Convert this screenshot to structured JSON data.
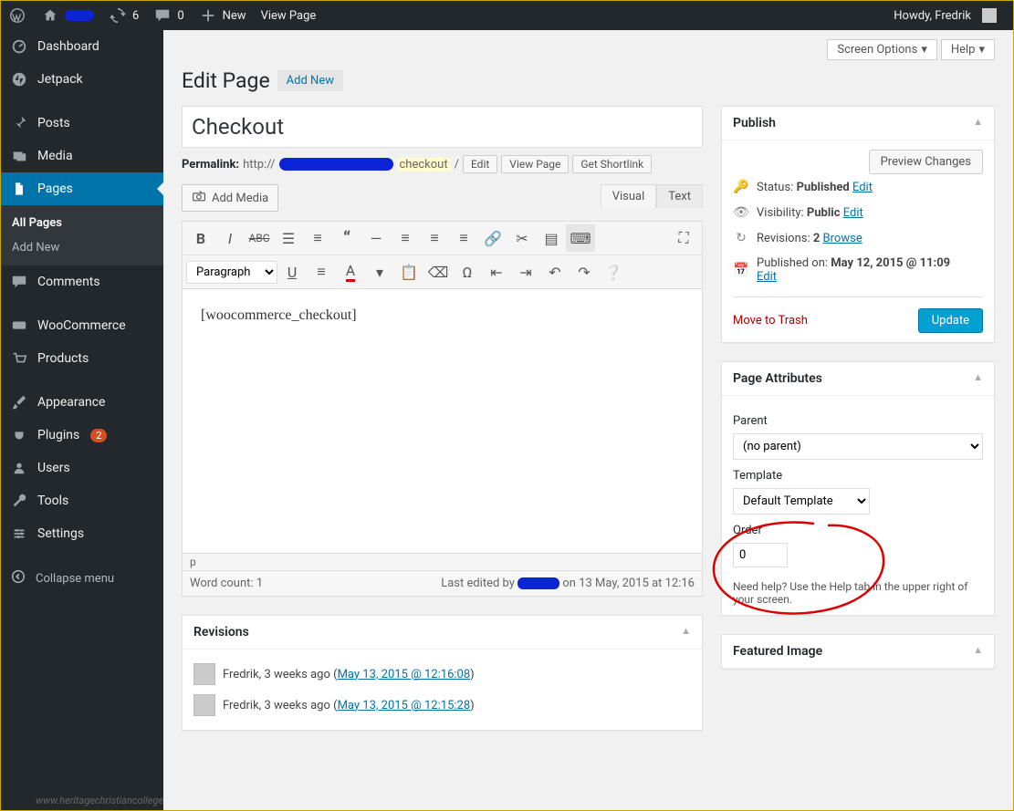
{
  "adminbar": {
    "comment_count": "0",
    "update_count": "6",
    "new_label": "New",
    "view_label": "View Page",
    "howdy": "Howdy, Fredrik"
  },
  "sidebar": {
    "items": [
      {
        "label": "Dashboard"
      },
      {
        "label": "Jetpack"
      },
      {
        "label": "Posts"
      },
      {
        "label": "Media"
      },
      {
        "label": "Pages"
      },
      {
        "label": "Comments"
      },
      {
        "label": "WooCommerce"
      },
      {
        "label": "Products"
      },
      {
        "label": "Appearance"
      },
      {
        "label": "Plugins"
      },
      {
        "label": "Users"
      },
      {
        "label": "Tools"
      },
      {
        "label": "Settings"
      }
    ],
    "plugins_badge": "2",
    "submenu": {
      "all": "All Pages",
      "add": "Add New"
    },
    "collapse": "Collapse menu"
  },
  "screen_options": "Screen Options",
  "help": "Help",
  "page_title": "Edit Page",
  "add_new": "Add New",
  "title_value": "Checkout",
  "permalink": {
    "label": "Permalink:",
    "prefix": "http://",
    "slug": "checkout",
    "tail": "/",
    "edit": "Edit",
    "view": "View Page",
    "shortlink": "Get Shortlink"
  },
  "media_button": "Add Media",
  "editor_tabs": {
    "visual": "Visual",
    "text": "Text"
  },
  "paragraph_label": "Paragraph",
  "editor_content": "[woocommerce_checkout]",
  "status_path": "p",
  "word_count_label": "Word count: 1",
  "last_edited_pre": "Last edited by ",
  "last_edited_post": " on 13 May, 2015 at 12:16",
  "revisions_box": {
    "title": "Revisions",
    "items": [
      {
        "who": "Fredrik, 3 weeks ago",
        "date": "May 13, 2015 @ 12:16:08"
      },
      {
        "who": "Fredrik, 3 weeks ago",
        "date": "May 13, 2015 @ 12:15:28"
      }
    ]
  },
  "publish": {
    "title": "Publish",
    "preview": "Preview Changes",
    "status_label": "Status:",
    "status_value": "Published",
    "visibility_label": "Visibility:",
    "visibility_value": "Public",
    "revisions_label": "Revisions:",
    "revisions_count": "2",
    "browse": "Browse",
    "published_label": "Published on:",
    "published_value": "May 12, 2015 @ 11:09",
    "edit": "Edit",
    "trash": "Move to Trash",
    "update": "Update"
  },
  "page_attr": {
    "title": "Page Attributes",
    "parent_label": "Parent",
    "parent_value": "(no parent)",
    "template_label": "Template",
    "template_value": "Default Template",
    "order_label": "Order",
    "order_value": "0",
    "help": "Need help? Use the Help tab in the upper right of your screen."
  },
  "featured": {
    "title": "Featured Image"
  },
  "bottom_credit": "www.heritagechristiancollege"
}
